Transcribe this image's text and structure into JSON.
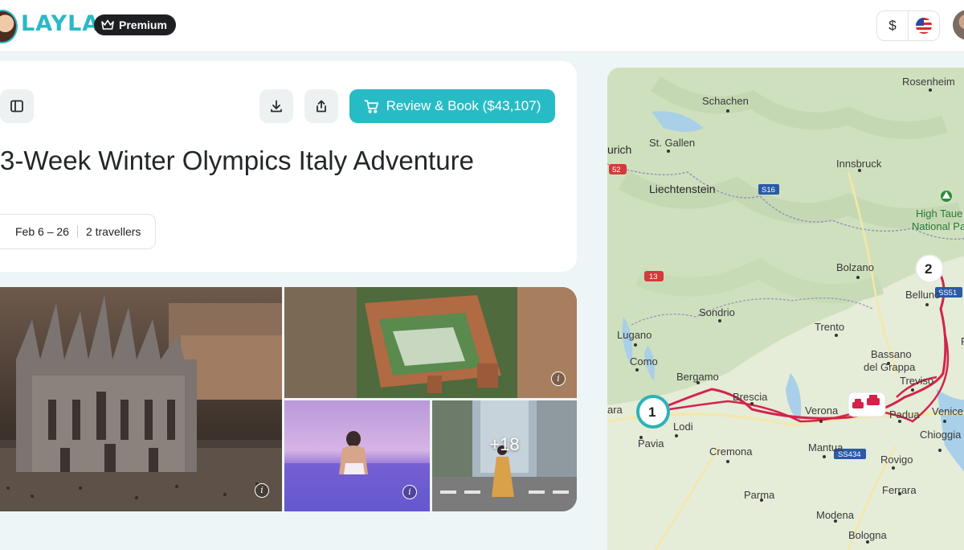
{
  "header": {
    "logo_text": "LAYLA",
    "premium_label": "Premium",
    "currency_symbol": "$",
    "flag_icon": "us-flag-icon"
  },
  "trip": {
    "book_label": "Review & Book ($43,107)",
    "title": "3-Week Winter Olympics Italy Adventure",
    "dates": "Feb 6 – 26",
    "travellers": "2 travellers"
  },
  "gallery": {
    "more_count": "+18",
    "photos": [
      "Milan Cathedral aerial",
      "Sforza Castle aerial",
      "Infinity pool",
      "Street crossing"
    ]
  },
  "map": {
    "places": [
      "Rosenheim",
      "Schachen",
      "urich",
      "St. Gallen",
      "Innsbruck",
      "Liechtenstein",
      "High Taue",
      "National Pa",
      "Bolzano",
      "Sondrio",
      "Lugano",
      "Belluno",
      "Trento",
      "Como",
      "Bassano",
      "del Grappa",
      "Bergamo",
      "Brescia",
      "Verona",
      "Treviso",
      "Padua",
      "Venice",
      "Lodi",
      "Pavia",
      "Cremona",
      "Mantua",
      "Rovigo",
      "Chioggia",
      "Ferrara",
      "Parma",
      "Modena",
      "Bologna",
      "Po",
      "ara"
    ],
    "roads": [
      "52",
      "S16",
      "13",
      "SS51",
      "SS434"
    ],
    "stops": [
      "1",
      "2"
    ],
    "colors": {
      "route": "#d3234b",
      "stop_ring": "#2bb3b8",
      "accent": "#27bcc5"
    }
  }
}
